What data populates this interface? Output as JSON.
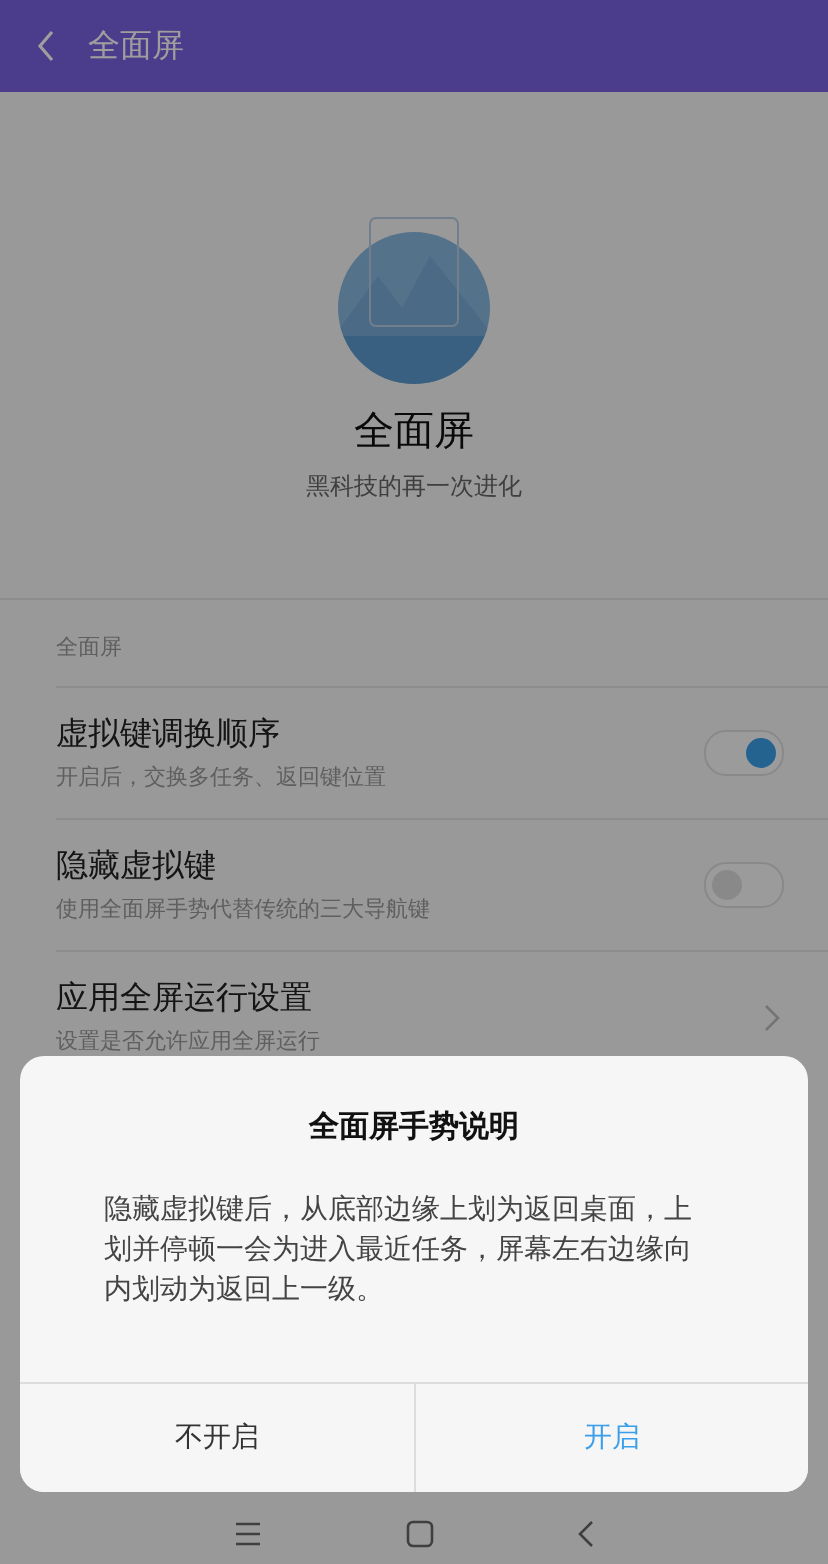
{
  "header": {
    "title": "全面屏"
  },
  "hero": {
    "title": "全面屏",
    "subtitle": "黑科技的再一次进化"
  },
  "section": {
    "label": "全面屏"
  },
  "items": [
    {
      "kind": "switch",
      "title": "虚拟键调换顺序",
      "subtitle": "开启后，交换多任务、返回键位置",
      "on": true
    },
    {
      "kind": "switch",
      "title": "隐藏虚拟键",
      "subtitle": "使用全面屏手势代替传统的三大导航键",
      "on": false
    },
    {
      "kind": "link",
      "title": "应用全屏运行设置",
      "subtitle": "设置是否允许应用全屏运行"
    }
  ],
  "dialog": {
    "title": "全面屏手势说明",
    "message": "隐藏虚拟键后，从底部边缘上划为返回桌面，上划并停顿一会为进入最近任务，屏幕左右边缘向内划动为返回上一级。",
    "buttons": [
      {
        "label": "不开启",
        "primary": false
      },
      {
        "label": "开启",
        "primary": true
      }
    ]
  }
}
